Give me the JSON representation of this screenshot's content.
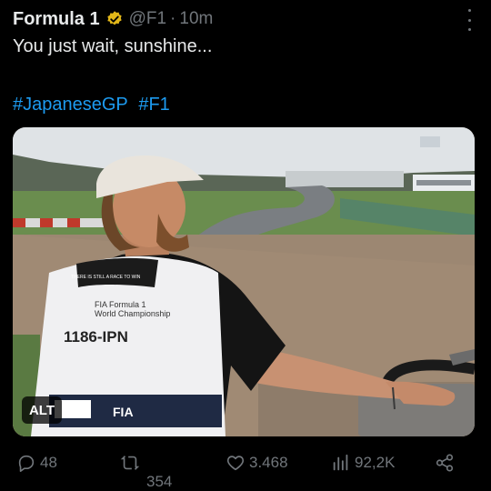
{
  "post": {
    "author_name": "Formula 1",
    "handle": "@F1",
    "separator": "·",
    "time": "10m",
    "text": "You just wait, sunshine...",
    "hashtags": [
      "#JapaneseGP",
      "#F1"
    ]
  },
  "media": {
    "alt_badge": "ALT",
    "bib_sponsor_line": "THERE IS STILL A RACE TO WIN",
    "bib_brand_line1": "FIA Formula 1",
    "bib_brand_line2": "World Championship",
    "bib_number": "1186-IPN",
    "bib_fia": "FIA"
  },
  "actions": {
    "replies": "48",
    "reposts": "354",
    "likes": "3.468",
    "views": "92,2K"
  },
  "colors": {
    "background": "#000000",
    "text": "#e7e9ea",
    "muted": "#71767b",
    "link": "#1d9bf0",
    "verified_gold": "#e2b719"
  },
  "icons": {
    "verified": "verified-badge-icon",
    "more": "more-options-icon",
    "reply": "reply-icon",
    "repost": "repost-icon",
    "like": "heart-icon",
    "views": "views-icon",
    "share": "share-icon"
  }
}
